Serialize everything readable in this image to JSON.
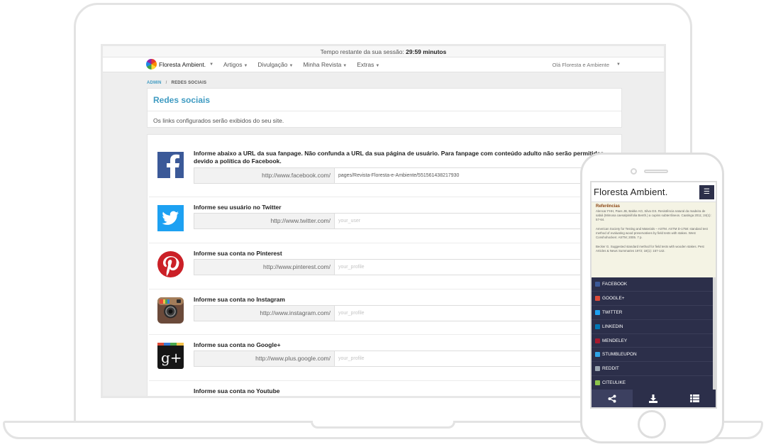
{
  "session": {
    "text": "Tempo restante da sua sessão:",
    "time": "29:59 minutos"
  },
  "nav": {
    "brand": "Floresta Ambient.",
    "menu": [
      "Artigos",
      "Divulgação",
      "Minha Revista",
      "Extras"
    ],
    "user": "Olá Floresta e Ambiente"
  },
  "breadcrumb": {
    "root": "ADMIN",
    "sep": "/",
    "current": "REDES SOCIAIS"
  },
  "header": {
    "title": "Redes sociais",
    "subtitle": "Os links configurados serão exibidos do seu site."
  },
  "rows": [
    {
      "icon": "facebook-icon",
      "label": "Informe abaixo a URL da sua fanpage. Não confunda a URL da sua página de usuário. Para fanpage com conteúdo adulto não serão permitidas devido a política do Facebook.",
      "prefix": "http://www.facebook.com/",
      "value": "pages/Revista-Floresta-e-Ambiente/551561438217930",
      "placeholder": ""
    },
    {
      "icon": "twitter-icon",
      "label": "Informe seu usuário no Twitter",
      "prefix": "http://www.twitter.com/",
      "value": "",
      "placeholder": "your_user"
    },
    {
      "icon": "pinterest-icon",
      "label": "Informe sua conta no Pinterest",
      "prefix": "http://www.pinterest.com/",
      "value": "",
      "placeholder": "your_profile"
    },
    {
      "icon": "instagram-icon",
      "label": "Informe sua conta no Instagram",
      "prefix": "http://www.instagram.com/",
      "value": "",
      "placeholder": "your_profile"
    },
    {
      "icon": "google-plus-icon",
      "label": "Informe sua conta no Google+",
      "prefix": "http://www.plus.google.com/",
      "value": "",
      "placeholder": "your_profile"
    },
    {
      "icon": "youtube-icon",
      "label": "Informe sua conta no Youtube",
      "prefix": "",
      "value": "",
      "placeholder": ""
    }
  ],
  "phone": {
    "title": "Floresta Ambient.",
    "refs_heading": "Referências",
    "refs": [
      "Alencar FHH, Paes JB, Bakke AO, Silva GS. Resistência natural da madeira de sabiá (Mimosa caesalpiniifolia Benth.) a cupins subterrâneos. Caatinga 2011; 24(1): 57-64.",
      "American Society for Testing and Materials – ASTM. ASTM D-1758: standard test method of evaluating wood preservatives by field tests with stakes. West Conshohocken: ASTM; 2005. 7 p.",
      "Becker G. Suggested standard method for field tests with wooden stakes. Pest Articles & News Summaries 1972; 18(1): 157-142."
    ],
    "share": [
      {
        "label": "FACEBOOK",
        "color": "#3b5998"
      },
      {
        "label": "GOOGLE+",
        "color": "#dd4b39"
      },
      {
        "label": "TWITTER",
        "color": "#1da1f2"
      },
      {
        "label": "LINKEDIN",
        "color": "#0077b5"
      },
      {
        "label": "MENDELEY",
        "color": "#a6192e"
      },
      {
        "label": "STUMBLEUPON",
        "color": "#2fa4e7"
      },
      {
        "label": "REDDIT",
        "color": "#9aa5b0"
      },
      {
        "label": "CITEULIKE",
        "color": "#8bc34a"
      }
    ],
    "tabs": [
      "share-icon",
      "download-icon",
      "list-icon"
    ]
  }
}
